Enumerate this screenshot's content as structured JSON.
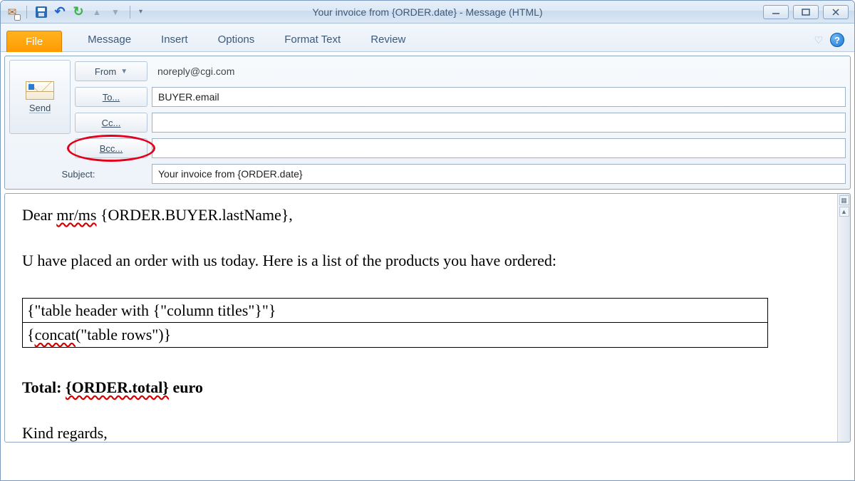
{
  "window": {
    "title": "Your invoice from {ORDER.date}  -  Message (HTML)"
  },
  "ribbon": {
    "file": "File",
    "tabs": [
      "Message",
      "Insert",
      "Options",
      "Format Text",
      "Review"
    ]
  },
  "compose": {
    "send": "Send",
    "from_label": "From",
    "from_value": "noreply@cgi.com",
    "to_label": "To...",
    "to_value": "BUYER.email",
    "cc_label": "Cc...",
    "cc_value": "",
    "bcc_label": "Bcc...",
    "bcc_value": "",
    "subject_label": "Subject:",
    "subject_value": "Your invoice from {ORDER.date}"
  },
  "body": {
    "greeting_prefix": "Dear ",
    "greeting_mrms": "mr/ms",
    "greeting_name": " {ORDER.BUYER.lastName},",
    "para1": "U have placed an order with us today. Here is a list of the products you have ordered:",
    "table_header": "{\"table header with {\"column titles\"}\"}",
    "table_rows_prefix": "{",
    "table_rows_concat": "concat",
    "table_rows_suffix": "(\"table rows\")}",
    "total_label": "Total: ",
    "total_value": "{ORDER.total}",
    "total_unit": " euro",
    "closing": "Kind regards,"
  }
}
